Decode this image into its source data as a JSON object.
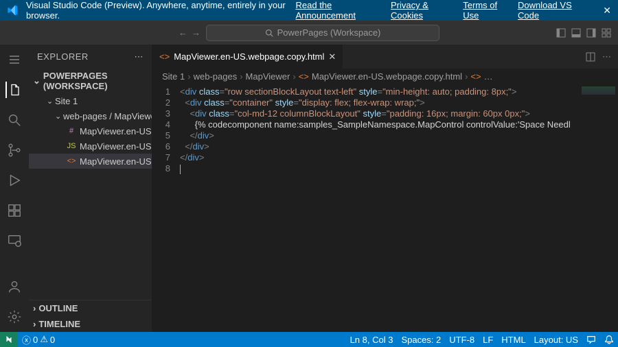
{
  "banner": {
    "title": "Visual Studio Code (Preview). Anywhere, anytime, entirely in your browser.",
    "announcement": "Read the Announcement",
    "privacy": "Privacy & Cookies",
    "terms": "Terms of Use",
    "download": "Download VS Code"
  },
  "search_placeholder": "PowerPages (Workspace)",
  "sidebar": {
    "title": "EXPLORER",
    "workspace": "POWERPAGES (WORKSPACE)",
    "tree": {
      "site1": "Site 1",
      "folder_path": "web-pages / MapViewer",
      "files": [
        {
          "icon": "#",
          "icon_color": "#c586c0",
          "name": "MapViewer.en-US.customc…"
        },
        {
          "icon": "JS",
          "icon_color": "#cbcb41",
          "name": "MapViewer.en-US.customj…"
        },
        {
          "icon": "<>",
          "icon_color": "#e37933",
          "name": "MapViewer.en-US.webpag…"
        }
      ]
    },
    "outline": "OUTLINE",
    "timeline": "TIMELINE"
  },
  "tab": {
    "name": "MapViewer.en-US.webpage.copy.html"
  },
  "breadcrumbs": [
    "Site 1",
    "web-pages",
    "MapViewer",
    "MapViewer.en-US.webpage.copy.html",
    "…"
  ],
  "code": {
    "line_numbers": [
      "1",
      "2",
      "3",
      "4",
      "5",
      "6",
      "7",
      "8"
    ],
    "lines": [
      [
        {
          "c": "t-punc",
          "t": "<"
        },
        {
          "c": "t-tag",
          "t": "div"
        },
        {
          "c": "t-txt",
          "t": " "
        },
        {
          "c": "t-attr",
          "t": "class"
        },
        {
          "c": "t-punc",
          "t": "="
        },
        {
          "c": "t-str",
          "t": "\"row sectionBlockLayout text-left\""
        },
        {
          "c": "t-txt",
          "t": " "
        },
        {
          "c": "t-attr",
          "t": "style"
        },
        {
          "c": "t-punc",
          "t": "="
        },
        {
          "c": "t-str",
          "t": "\"min-height: auto; padding: 8px;\""
        },
        {
          "c": "t-punc",
          "t": ">"
        }
      ],
      [
        {
          "c": "t-txt",
          "t": "  "
        },
        {
          "c": "t-punc",
          "t": "<"
        },
        {
          "c": "t-tag",
          "t": "div"
        },
        {
          "c": "t-txt",
          "t": " "
        },
        {
          "c": "t-attr",
          "t": "class"
        },
        {
          "c": "t-punc",
          "t": "="
        },
        {
          "c": "t-str",
          "t": "\"container\""
        },
        {
          "c": "t-txt",
          "t": " "
        },
        {
          "c": "t-attr",
          "t": "style"
        },
        {
          "c": "t-punc",
          "t": "="
        },
        {
          "c": "t-str",
          "t": "\"display: flex; flex-wrap: wrap;\""
        },
        {
          "c": "t-punc",
          "t": ">"
        }
      ],
      [
        {
          "c": "t-txt",
          "t": "    "
        },
        {
          "c": "t-punc",
          "t": "<"
        },
        {
          "c": "t-tag",
          "t": "div"
        },
        {
          "c": "t-txt",
          "t": " "
        },
        {
          "c": "t-attr",
          "t": "class"
        },
        {
          "c": "t-punc",
          "t": "="
        },
        {
          "c": "t-str",
          "t": "\"col-md-12 columnBlockLayout\""
        },
        {
          "c": "t-txt",
          "t": " "
        },
        {
          "c": "t-attr",
          "t": "style"
        },
        {
          "c": "t-punc",
          "t": "="
        },
        {
          "c": "t-str",
          "t": "\"padding: 16px; margin: 60px 0px;\""
        },
        {
          "c": "t-punc",
          "t": ">"
        }
      ],
      [
        {
          "c": "t-txt",
          "t": "      {% codecomponent name:samples_SampleNamespace.MapControl controlValue:'Space Needl"
        }
      ],
      [
        {
          "c": "t-txt",
          "t": "    "
        },
        {
          "c": "t-punc",
          "t": "</"
        },
        {
          "c": "t-tag",
          "t": "div"
        },
        {
          "c": "t-punc",
          "t": ">"
        }
      ],
      [
        {
          "c": "t-txt",
          "t": "  "
        },
        {
          "c": "t-punc",
          "t": "</"
        },
        {
          "c": "t-tag",
          "t": "div"
        },
        {
          "c": "t-punc",
          "t": ">"
        }
      ],
      [
        {
          "c": "t-punc",
          "t": "</"
        },
        {
          "c": "t-tag",
          "t": "div"
        },
        {
          "c": "t-punc",
          "t": ">"
        }
      ],
      [
        {
          "c": "cursor",
          "t": ""
        }
      ]
    ]
  },
  "status": {
    "errors": "0",
    "warnings": "0",
    "ln_col": "Ln 8, Col 3",
    "spaces": "Spaces: 2",
    "encoding": "UTF-8",
    "eol": "LF",
    "lang": "HTML",
    "layout": "Layout: US"
  }
}
